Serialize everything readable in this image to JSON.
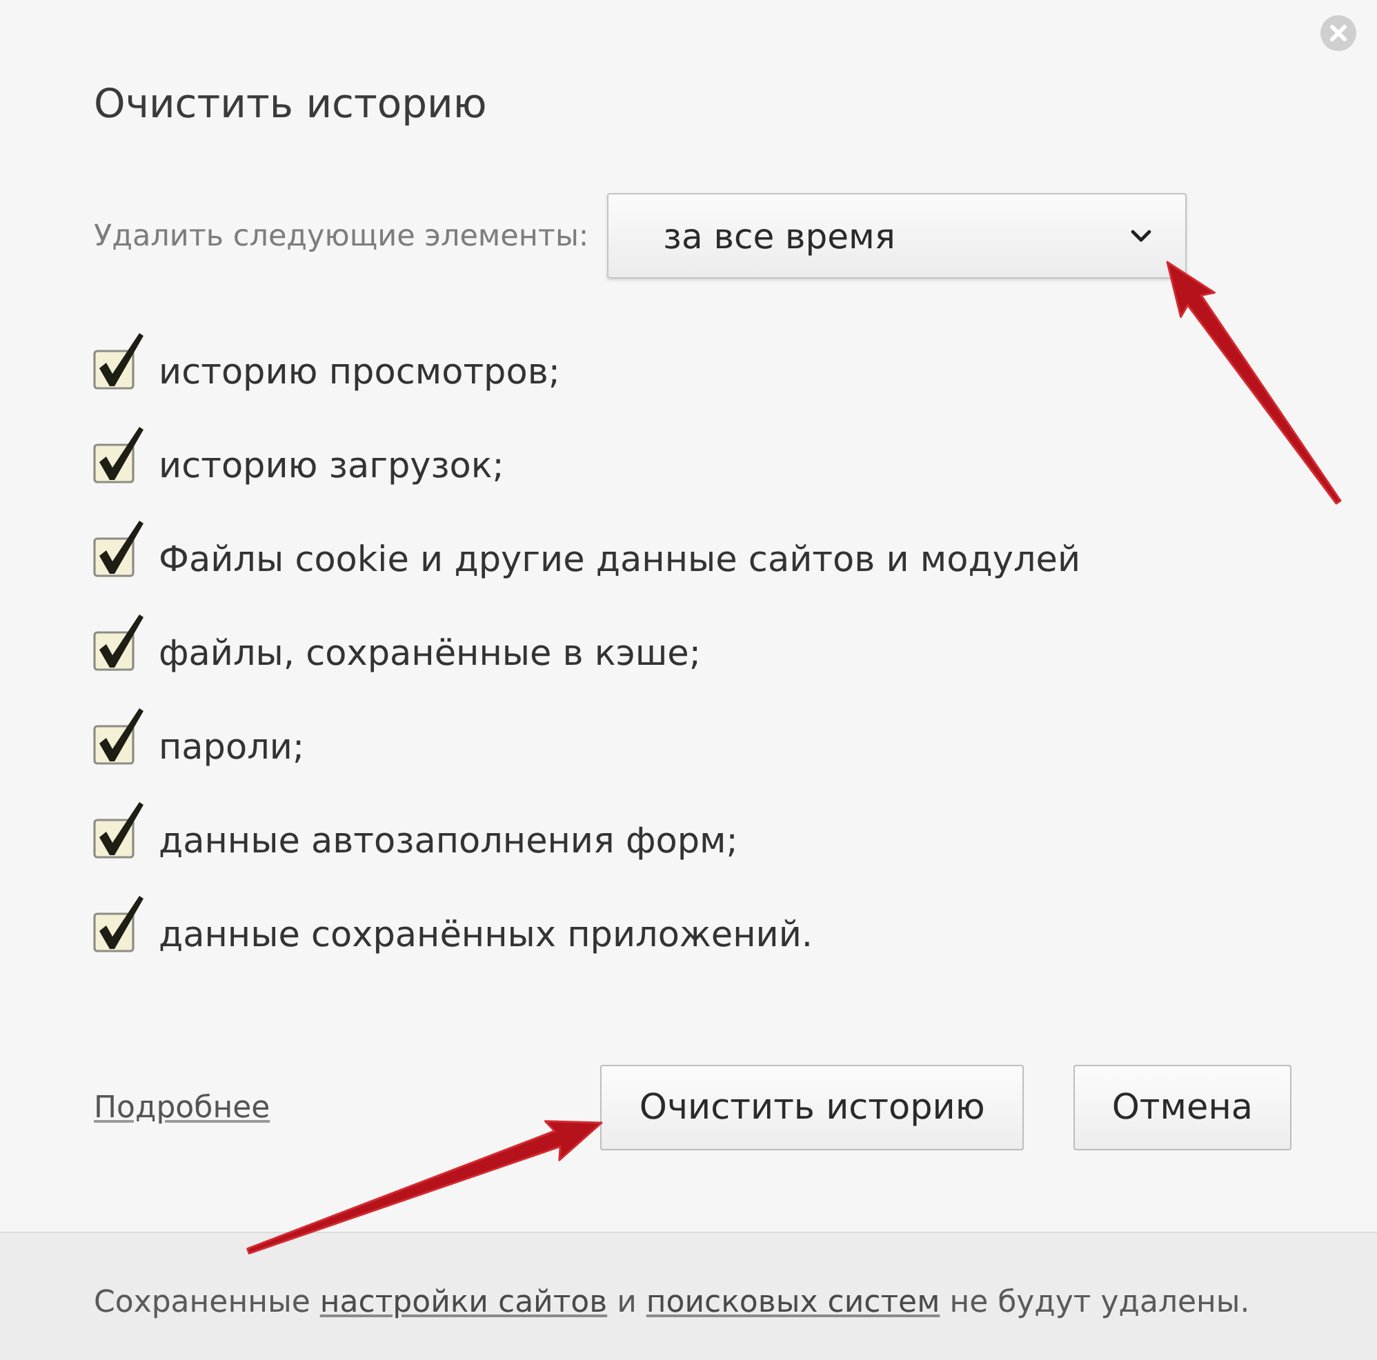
{
  "dialog": {
    "title": "Очистить историю"
  },
  "period": {
    "label": "Удалить следующие элементы:",
    "value": "за все время"
  },
  "items": [
    {
      "label": "историю просмотров;",
      "checked": true
    },
    {
      "label": "историю загрузок;",
      "checked": true
    },
    {
      "label": "Файлы cookie и другие данные сайтов и модулей",
      "checked": true
    },
    {
      "label": "файлы, сохранённые в кэше;",
      "checked": true
    },
    {
      "label": "пароли;",
      "checked": true
    },
    {
      "label": "данные автозаполнения форм;",
      "checked": true
    },
    {
      "label": "данные сохранённых приложений.",
      "checked": true
    }
  ],
  "more_link": "Подробнее",
  "buttons": [
    "Очистить историю",
    "Отмена"
  ],
  "footer": {
    "segments": [
      {
        "kind": "text",
        "text": "Сохраненные"
      },
      {
        "kind": "link",
        "text": "настройки сайтов"
      },
      {
        "kind": "text",
        "text": "и"
      },
      {
        "kind": "link",
        "text": "поисковых систем"
      },
      {
        "kind": "text",
        "text": "не будут удалены."
      }
    ]
  }
}
